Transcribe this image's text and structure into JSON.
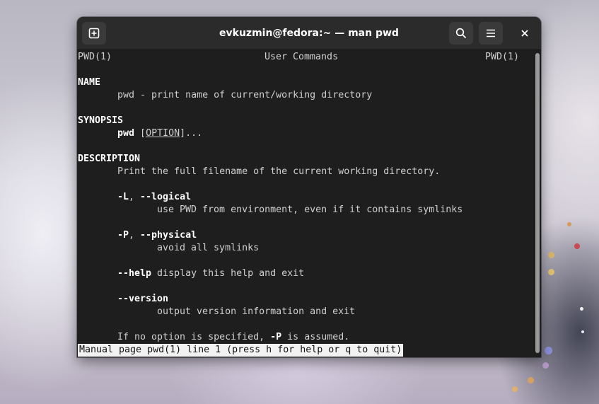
{
  "window": {
    "title": "evkuzmin@fedora:~ — man pwd"
  },
  "icons": {
    "new_tab": "plus-square-icon",
    "search": "search-icon",
    "menu": "hamburger-menu-icon",
    "close": "close-icon"
  },
  "manpage": {
    "header_left": "PWD(1)",
    "header_center": "User Commands",
    "header_right": "PWD(1)",
    "name_heading": "NAME",
    "name_text": "pwd - print name of current/working directory",
    "synopsis_heading": "SYNOPSIS",
    "synopsis_cmd": "pwd",
    "synopsis_open": "[",
    "synopsis_option": "OPTION",
    "synopsis_close": "]...",
    "description_heading": "DESCRIPTION",
    "description_text": "Print the full filename of the current working directory.",
    "opt_L_short": "-L",
    "opt_sep1": ", ",
    "opt_L_long": "--logical",
    "opt_L_desc": "use PWD from environment, even if it contains symlinks",
    "opt_P_short": "-P",
    "opt_sep2": ", ",
    "opt_P_long": "--physical",
    "opt_P_desc": "avoid all symlinks",
    "opt_help": "--help",
    "opt_help_desc": " display this help and exit",
    "opt_version": "--version",
    "opt_version_desc": "output version information and exit",
    "footer_prefix": "If no option is specified, ",
    "footer_flag": "-P",
    "footer_suffix": " is assumed."
  },
  "status": {
    "text": "Manual page pwd(1) line 1 (press h for help or q to quit)"
  },
  "colors": {
    "terminal_bg": "#1e1e1e",
    "titlebar_bg": "#2b2b2b",
    "text": "#d0d0d0",
    "status_bg": "#f2f2f2"
  }
}
